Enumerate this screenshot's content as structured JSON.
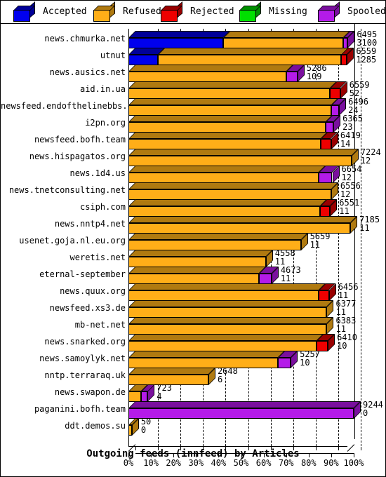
{
  "legend": {
    "items": [
      {
        "label": "Accepted",
        "color": "#0000EE",
        "top": "#000099",
        "side": "#000099"
      },
      {
        "label": "Refused",
        "color": "#FFAE18",
        "top": "#B07A10",
        "side": "#B07A10"
      },
      {
        "label": "Rejected",
        "color": "#EE0000",
        "top": "#990000",
        "side": "#990000"
      },
      {
        "label": "Missing",
        "color": "#00E000",
        "top": "#009000",
        "side": "#009000"
      },
      {
        "label": "Spooled",
        "color": "#B41BE8",
        "top": "#7A0F9E",
        "side": "#7A0F9E"
      }
    ]
  },
  "axis": {
    "x_ticks": [
      "0%",
      "10%",
      "20%",
      "30%",
      "40%",
      "50%",
      "60%",
      "70%",
      "80%",
      "90%",
      "100%"
    ],
    "x_min": 0,
    "x_max": 100
  },
  "title": "Outgoing feeds (innfeed) by Articles",
  "chart_data": {
    "type": "bar",
    "orientation": "horizontal-stacked",
    "title": "Outgoing feeds (innfeed) by Articles",
    "xlabel": "Outgoing feeds (innfeed) by Articles",
    "ylabel": "",
    "xlim": [
      0,
      100
    ],
    "x_unit": "percent",
    "grid": true,
    "legend_position": "top",
    "series_names": [
      "Accepted",
      "Refused",
      "Rejected",
      "Missing",
      "Spooled"
    ],
    "series_colors": [
      "#0000EE",
      "#FFAE18",
      "#EE0000",
      "#00E000",
      "#B41BE8"
    ],
    "categories": [
      "news.chmurka.net",
      "utnut",
      "news.ausics.net",
      "aid.in.ua",
      "newsfeed.endofthelinebbs.com",
      "i2pn.org",
      "newsfeed.bofh.team",
      "news.hispagatos.org",
      "news.1d4.us",
      "news.tnetconsulting.net",
      "csiph.com",
      "news.nntp4.net",
      "usenet.goja.nl.eu.org",
      "weretis.net",
      "eternal-september",
      "news.quux.org",
      "newsfeed.xs3.de",
      "mb-net.net",
      "news.snarked.org",
      "news.samoylyk.net",
      "nntp.terraraq.uk",
      "news.swapon.de",
      "paganini.bofh.team",
      "ddt.demos.su"
    ],
    "rows": [
      {
        "label": "news.chmurka.net",
        "total": 6495,
        "second": 3100,
        "segments": [
          {
            "s": "Accepted",
            "pct": 42.0
          },
          {
            "s": "Refused",
            "pct": 53.3
          },
          {
            "s": "Spooled",
            "pct": 2.0
          }
        ]
      },
      {
        "label": "utnut",
        "total": 6559,
        "second": 1285,
        "segments": [
          {
            "s": "Accepted",
            "pct": 13.0
          },
          {
            "s": "Refused",
            "pct": 81.5
          },
          {
            "s": "Rejected",
            "pct": 2.5
          }
        ]
      },
      {
        "label": "news.ausics.net",
        "total": 5286,
        "second": 109,
        "segments": [
          {
            "s": "Refused",
            "pct": 70.0
          },
          {
            "s": "Spooled",
            "pct": 5.0
          }
        ]
      },
      {
        "label": "aid.in.ua",
        "total": 6559,
        "second": 52,
        "segments": [
          {
            "s": "Refused",
            "pct": 89.5
          },
          {
            "s": "Rejected",
            "pct": 4.5
          }
        ]
      },
      {
        "label": "newsfeed.endofthelinebbs.com",
        "total": 6496,
        "second": 24,
        "segments": [
          {
            "s": "Refused",
            "pct": 90.0
          },
          {
            "s": "Spooled",
            "pct": 3.5
          }
        ]
      },
      {
        "label": "i2pn.org",
        "total": 6365,
        "second": 23,
        "segments": [
          {
            "s": "Refused",
            "pct": 87.5
          },
          {
            "s": "Spooled",
            "pct": 3.5
          }
        ]
      },
      {
        "label": "newsfeed.bofh.team",
        "total": 6419,
        "second": 14,
        "segments": [
          {
            "s": "Refused",
            "pct": 85.5
          },
          {
            "s": "Rejected",
            "pct": 4.5
          }
        ]
      },
      {
        "label": "news.hispagatos.org",
        "total": 7224,
        "second": 12,
        "segments": [
          {
            "s": "Refused",
            "pct": 99.0
          }
        ]
      },
      {
        "label": "news.1d4.us",
        "total": 6654,
        "second": 12,
        "segments": [
          {
            "s": "Refused",
            "pct": 84.5
          },
          {
            "s": "Spooled",
            "pct": 6.0
          }
        ]
      },
      {
        "label": "news.tnetconsulting.net",
        "total": 6556,
        "second": 12,
        "segments": [
          {
            "s": "Refused",
            "pct": 90.0
          }
        ]
      },
      {
        "label": "csiph.com",
        "total": 6551,
        "second": 11,
        "segments": [
          {
            "s": "Refused",
            "pct": 85.0
          },
          {
            "s": "Rejected",
            "pct": 4.5
          }
        ]
      },
      {
        "label": "news.nntp4.net",
        "total": 7185,
        "second": 11,
        "segments": [
          {
            "s": "Refused",
            "pct": 98.5
          }
        ]
      },
      {
        "label": "usenet.goja.nl.eu.org",
        "total": 5659,
        "second": 11,
        "segments": [
          {
            "s": "Refused",
            "pct": 76.5
          }
        ]
      },
      {
        "label": "weretis.net",
        "total": 4558,
        "second": 11,
        "segments": [
          {
            "s": "Refused",
            "pct": 61.0
          }
        ]
      },
      {
        "label": "eternal-september",
        "total": 4673,
        "second": 11,
        "segments": [
          {
            "s": "Refused",
            "pct": 58.0
          },
          {
            "s": "Spooled",
            "pct": 5.5
          }
        ]
      },
      {
        "label": "news.quux.org",
        "total": 6456,
        "second": 11,
        "segments": [
          {
            "s": "Refused",
            "pct": 84.5
          },
          {
            "s": "Rejected",
            "pct": 4.5
          }
        ]
      },
      {
        "label": "newsfeed.xs3.de",
        "total": 6377,
        "second": 11,
        "segments": [
          {
            "s": "Refused",
            "pct": 88.0
          }
        ]
      },
      {
        "label": "mb-net.net",
        "total": 6383,
        "second": 11,
        "segments": [
          {
            "s": "Refused",
            "pct": 88.0
          }
        ]
      },
      {
        "label": "news.snarked.org",
        "total": 6410,
        "second": 10,
        "segments": [
          {
            "s": "Refused",
            "pct": 83.5
          },
          {
            "s": "Rejected",
            "pct": 5.0
          }
        ]
      },
      {
        "label": "news.samoylyk.net",
        "total": 5257,
        "second": 10,
        "segments": [
          {
            "s": "Refused",
            "pct": 66.5
          },
          {
            "s": "Spooled",
            "pct": 5.5
          }
        ]
      },
      {
        "label": "nntp.terraraq.uk",
        "total": 2648,
        "second": 6,
        "segments": [
          {
            "s": "Refused",
            "pct": 35.5
          }
        ]
      },
      {
        "label": "news.swapon.de",
        "total": 723,
        "second": 4,
        "segments": [
          {
            "s": "Refused",
            "pct": 5.5
          },
          {
            "s": "Spooled",
            "pct": 3.0
          }
        ]
      },
      {
        "label": "paganini.bofh.team",
        "total": 9244,
        "second": 0,
        "segments": [
          {
            "s": "Spooled",
            "pct": 100.0
          }
        ]
      },
      {
        "label": "ddt.demos.su",
        "total": 50,
        "second": 0,
        "segments": [
          {
            "s": "Refused",
            "pct": 1.5
          }
        ]
      }
    ]
  }
}
